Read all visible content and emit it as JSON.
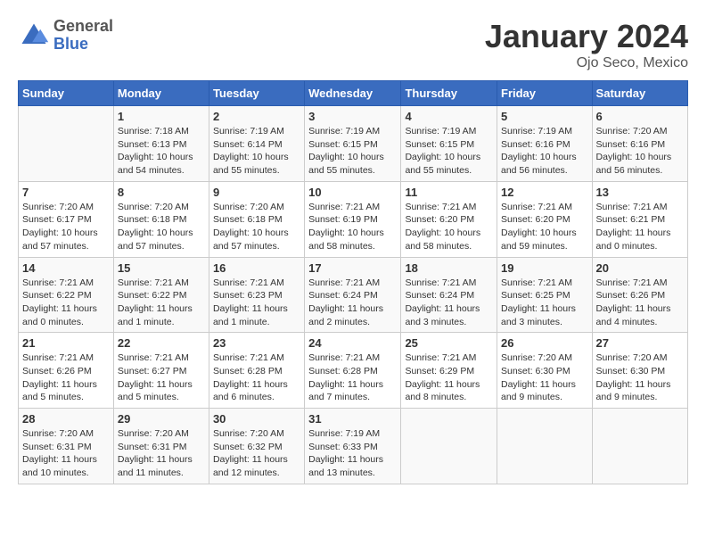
{
  "header": {
    "logo_line1": "General",
    "logo_line2": "Blue",
    "title": "January 2024",
    "subtitle": "Ojo Seco, Mexico"
  },
  "calendar": {
    "days_of_week": [
      "Sunday",
      "Monday",
      "Tuesday",
      "Wednesday",
      "Thursday",
      "Friday",
      "Saturday"
    ],
    "weeks": [
      [
        {
          "day": "",
          "info": ""
        },
        {
          "day": "1",
          "info": "Sunrise: 7:18 AM\nSunset: 6:13 PM\nDaylight: 10 hours\nand 54 minutes."
        },
        {
          "day": "2",
          "info": "Sunrise: 7:19 AM\nSunset: 6:14 PM\nDaylight: 10 hours\nand 55 minutes."
        },
        {
          "day": "3",
          "info": "Sunrise: 7:19 AM\nSunset: 6:15 PM\nDaylight: 10 hours\nand 55 minutes."
        },
        {
          "day": "4",
          "info": "Sunrise: 7:19 AM\nSunset: 6:15 PM\nDaylight: 10 hours\nand 55 minutes."
        },
        {
          "day": "5",
          "info": "Sunrise: 7:19 AM\nSunset: 6:16 PM\nDaylight: 10 hours\nand 56 minutes."
        },
        {
          "day": "6",
          "info": "Sunrise: 7:20 AM\nSunset: 6:16 PM\nDaylight: 10 hours\nand 56 minutes."
        }
      ],
      [
        {
          "day": "7",
          "info": "Sunrise: 7:20 AM\nSunset: 6:17 PM\nDaylight: 10 hours\nand 57 minutes."
        },
        {
          "day": "8",
          "info": "Sunrise: 7:20 AM\nSunset: 6:18 PM\nDaylight: 10 hours\nand 57 minutes."
        },
        {
          "day": "9",
          "info": "Sunrise: 7:20 AM\nSunset: 6:18 PM\nDaylight: 10 hours\nand 57 minutes."
        },
        {
          "day": "10",
          "info": "Sunrise: 7:21 AM\nSunset: 6:19 PM\nDaylight: 10 hours\nand 58 minutes."
        },
        {
          "day": "11",
          "info": "Sunrise: 7:21 AM\nSunset: 6:20 PM\nDaylight: 10 hours\nand 58 minutes."
        },
        {
          "day": "12",
          "info": "Sunrise: 7:21 AM\nSunset: 6:20 PM\nDaylight: 10 hours\nand 59 minutes."
        },
        {
          "day": "13",
          "info": "Sunrise: 7:21 AM\nSunset: 6:21 PM\nDaylight: 11 hours\nand 0 minutes."
        }
      ],
      [
        {
          "day": "14",
          "info": "Sunrise: 7:21 AM\nSunset: 6:22 PM\nDaylight: 11 hours\nand 0 minutes."
        },
        {
          "day": "15",
          "info": "Sunrise: 7:21 AM\nSunset: 6:22 PM\nDaylight: 11 hours\nand 1 minute."
        },
        {
          "day": "16",
          "info": "Sunrise: 7:21 AM\nSunset: 6:23 PM\nDaylight: 11 hours\nand 1 minute."
        },
        {
          "day": "17",
          "info": "Sunrise: 7:21 AM\nSunset: 6:24 PM\nDaylight: 11 hours\nand 2 minutes."
        },
        {
          "day": "18",
          "info": "Sunrise: 7:21 AM\nSunset: 6:24 PM\nDaylight: 11 hours\nand 3 minutes."
        },
        {
          "day": "19",
          "info": "Sunrise: 7:21 AM\nSunset: 6:25 PM\nDaylight: 11 hours\nand 3 minutes."
        },
        {
          "day": "20",
          "info": "Sunrise: 7:21 AM\nSunset: 6:26 PM\nDaylight: 11 hours\nand 4 minutes."
        }
      ],
      [
        {
          "day": "21",
          "info": "Sunrise: 7:21 AM\nSunset: 6:26 PM\nDaylight: 11 hours\nand 5 minutes."
        },
        {
          "day": "22",
          "info": "Sunrise: 7:21 AM\nSunset: 6:27 PM\nDaylight: 11 hours\nand 5 minutes."
        },
        {
          "day": "23",
          "info": "Sunrise: 7:21 AM\nSunset: 6:28 PM\nDaylight: 11 hours\nand 6 minutes."
        },
        {
          "day": "24",
          "info": "Sunrise: 7:21 AM\nSunset: 6:28 PM\nDaylight: 11 hours\nand 7 minutes."
        },
        {
          "day": "25",
          "info": "Sunrise: 7:21 AM\nSunset: 6:29 PM\nDaylight: 11 hours\nand 8 minutes."
        },
        {
          "day": "26",
          "info": "Sunrise: 7:20 AM\nSunset: 6:30 PM\nDaylight: 11 hours\nand 9 minutes."
        },
        {
          "day": "27",
          "info": "Sunrise: 7:20 AM\nSunset: 6:30 PM\nDaylight: 11 hours\nand 9 minutes."
        }
      ],
      [
        {
          "day": "28",
          "info": "Sunrise: 7:20 AM\nSunset: 6:31 PM\nDaylight: 11 hours\nand 10 minutes."
        },
        {
          "day": "29",
          "info": "Sunrise: 7:20 AM\nSunset: 6:31 PM\nDaylight: 11 hours\nand 11 minutes."
        },
        {
          "day": "30",
          "info": "Sunrise: 7:20 AM\nSunset: 6:32 PM\nDaylight: 11 hours\nand 12 minutes."
        },
        {
          "day": "31",
          "info": "Sunrise: 7:19 AM\nSunset: 6:33 PM\nDaylight: 11 hours\nand 13 minutes."
        },
        {
          "day": "",
          "info": ""
        },
        {
          "day": "",
          "info": ""
        },
        {
          "day": "",
          "info": ""
        }
      ]
    ]
  }
}
